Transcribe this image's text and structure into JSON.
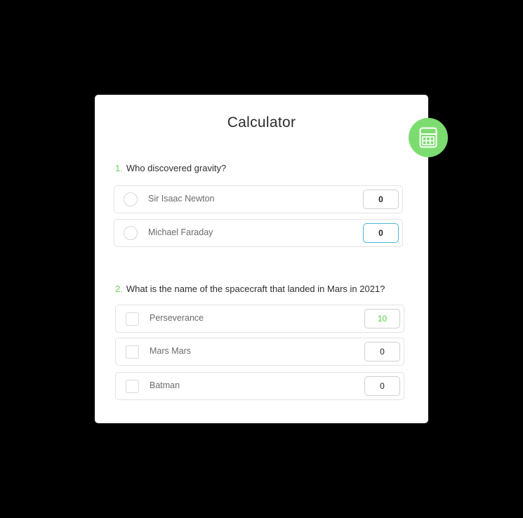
{
  "title": "Calculator",
  "badge": {
    "icon": "calculator-icon",
    "color": "#7ddc6f"
  },
  "questions": [
    {
      "number": "1.",
      "text": "Who discovered gravity?",
      "input_type": "radio",
      "options": [
        {
          "label": "Sir Isaac Newton",
          "score": "0"
        },
        {
          "label": "Michael Faraday",
          "score": "0",
          "focused": true
        }
      ]
    },
    {
      "number": "2.",
      "text": "What is the name of the spacecraft that landed in Mars in 2021?",
      "input_type": "checkbox",
      "options": [
        {
          "label": "Perseverance",
          "score": "10"
        },
        {
          "label": "Mars Mars",
          "score": "0"
        },
        {
          "label": "Batman",
          "score": "0"
        }
      ]
    }
  ],
  "colors": {
    "accent_green": "#7ddc6f",
    "number_green": "#6fcf5a",
    "focus_blue": "#49b9d6",
    "background": "#000000"
  }
}
